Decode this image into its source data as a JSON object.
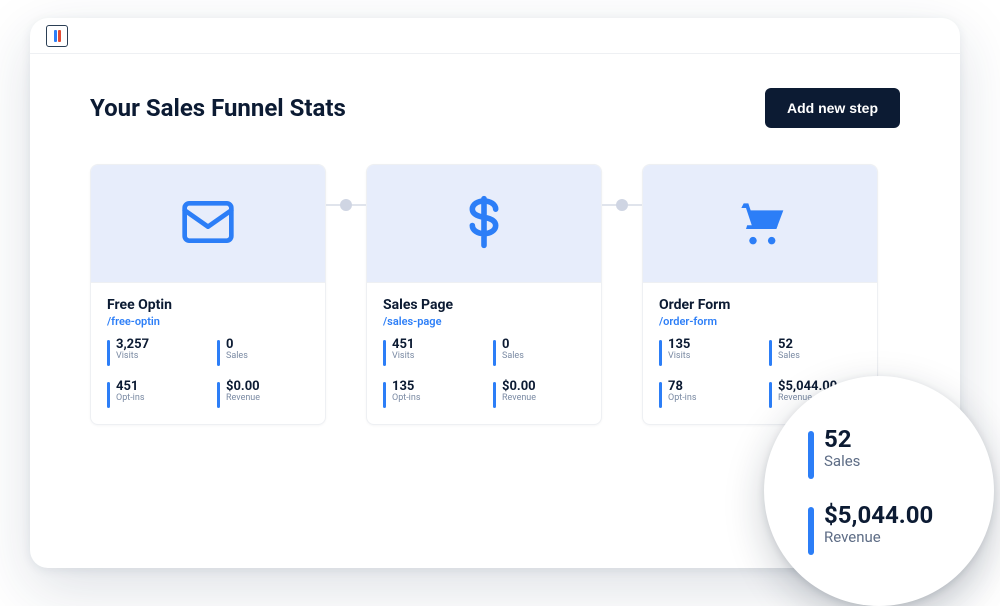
{
  "header": {
    "title": "Your Sales Funnel Stats",
    "add_button": "Add new step"
  },
  "steps": [
    {
      "name": "Free Optin",
      "slug": "/free-optin",
      "icon": "envelope-icon",
      "stats": [
        {
          "value": "3,257",
          "label": "Visits"
        },
        {
          "value": "0",
          "label": "Sales"
        },
        {
          "value": "451",
          "label": "Opt-ins"
        },
        {
          "value": "$0.00",
          "label": "Revenue"
        }
      ]
    },
    {
      "name": "Sales Page",
      "slug": "/sales-page",
      "icon": "dollar-icon",
      "stats": [
        {
          "value": "451",
          "label": "Visits"
        },
        {
          "value": "0",
          "label": "Sales"
        },
        {
          "value": "135",
          "label": "Opt-ins"
        },
        {
          "value": "$0.00",
          "label": "Revenue"
        }
      ]
    },
    {
      "name": "Order Form",
      "slug": "/order-form",
      "icon": "cart-icon",
      "stats": [
        {
          "value": "135",
          "label": "Visits"
        },
        {
          "value": "52",
          "label": "Sales"
        },
        {
          "value": "78",
          "label": "Opt-ins"
        },
        {
          "value": "$5,044.00",
          "label": "Revenue"
        }
      ]
    }
  ],
  "magnifier": {
    "sales": {
      "value": "52",
      "label": "Sales"
    },
    "revenue": {
      "value": "$5,044.00",
      "label": "Revenue"
    }
  }
}
